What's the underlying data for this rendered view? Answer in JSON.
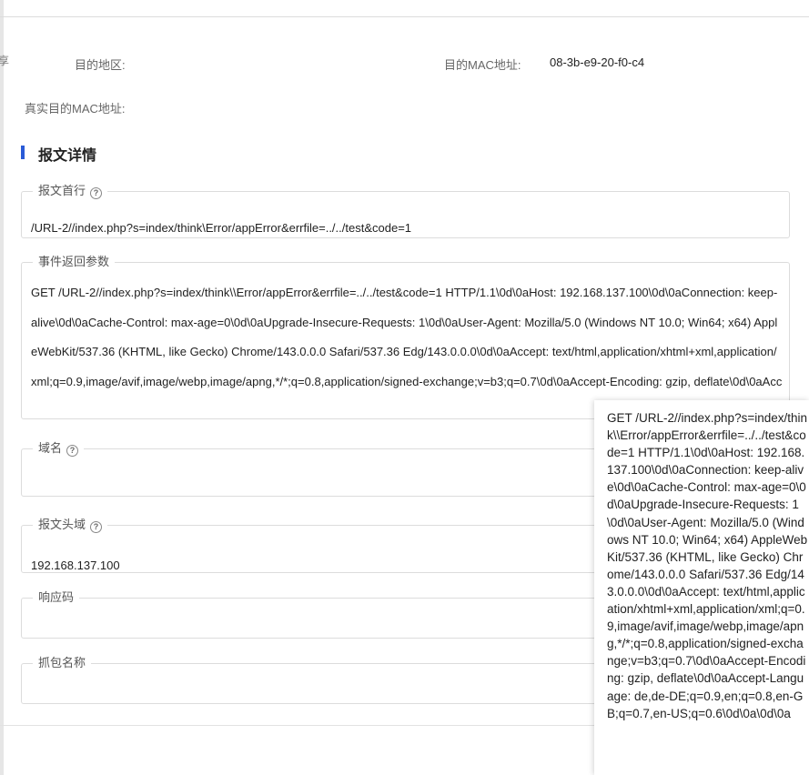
{
  "edge_char": "享",
  "info": {
    "dest_region_label": "目的地区:",
    "dest_region_value": "",
    "dest_mac_label": "目的MAC地址:",
    "dest_mac_value": "08-3b-e9-20-f0-c4",
    "real_dest_mac_label": "真实目的MAC地址:",
    "real_dest_mac_value": ""
  },
  "section": {
    "title": "报文详情",
    "accent_color": "#2a5bd7"
  },
  "fields": {
    "first_line": {
      "label": "报文首行",
      "value": "/URL-2//index.php?s=index/think\\Error/appError&errfile=../../test&code=1"
    },
    "event_params": {
      "label": "事件返回参数",
      "value": "GET /URL-2//index.php?s=index/think\\\\Error/appError&errfile=../../test&code=1 HTTP/1.1\\0d\\0aHost: 192.168.137.100\\0d\\0aConnection: keep-alive\\0d\\0aCache-Control: max-age=0\\0d\\0aUpgrade-Insecure-Requests: 1\\0d\\0aUser-Agent: Mozilla/5.0 (Windows NT 10.0; Win64; x64) AppleWebKit/537.36 (KHTML, like Gecko) Chrome/143.0.0.0 Safari/537.36 Edg/143.0.0.0\\0d\\0aAccept: text/html,application/xhtml+xml,application/xml;q=0.9,image/avif,image/webp,image/apng,*/*;q=0.8,application/signed-exchange;v=b3;q=0.7\\0d\\0aAccept-Encoding: gzip, deflate\\0d\\0aAccept-Language: de,de-DE;q=0.9,en;q=0.8,en-GB;q=0.7,en-US;q=0.6\\0d\\0a\\0d\\0a"
    },
    "domain": {
      "label": "域名",
      "value": ""
    },
    "header_field": {
      "label": "报文头域",
      "value": "192.168.137.100"
    },
    "response_code": {
      "label": "响应码",
      "value": ""
    },
    "capture_name": {
      "label": "抓包名称",
      "value": ""
    }
  },
  "tooltip": {
    "text": "GET /URL-2//index.php?s=index/think\\\\Error/appError&errfile=../../test&code=1 HTTP/1.1\\0d\\0aHost: 192.168.137.100\\0d\\0aConnection: keep-alive\\0d\\0aCache-Control: max-age=0\\0d\\0aUpgrade-Insecure-Requests: 1\\0d\\0aUser-Agent: Mozilla/5.0 (Windows NT 10.0; Win64; x64) AppleWebKit/537.36 (KHTML, like Gecko) Chrome/143.0.0.0 Safari/537.36 Edg/143.0.0.0\\0d\\0aAccept: text/html,application/xhtml+xml,application/xml;q=0.9,image/avif,image/webp,image/apng,*/*;q=0.8,application/signed-exchange;v=b3;q=0.7\\0d\\0aAccept-Encoding: gzip, deflate\\0d\\0aAccept-Language: de,de-DE;q=0.9,en;q=0.8,en-GB;q=0.7,en-US;q=0.6\\0d\\0a\\0d\\0a"
  },
  "icons": {
    "help": "question-circle-icon"
  }
}
